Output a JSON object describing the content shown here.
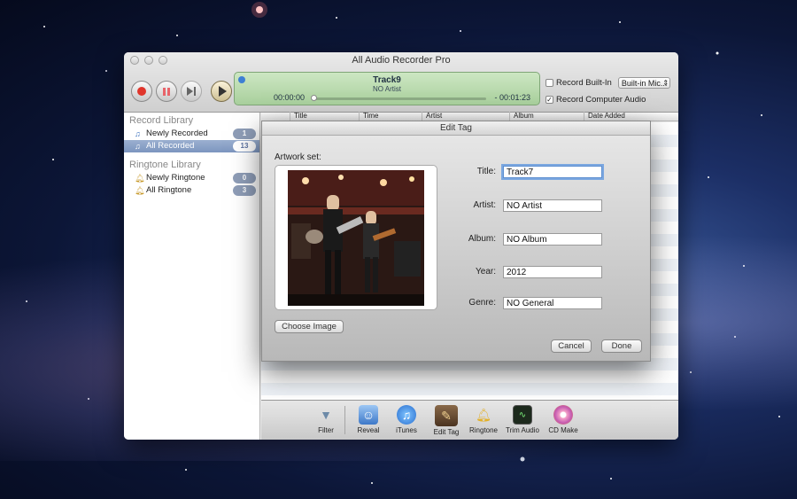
{
  "window": {
    "title": "All Audio Recorder Pro"
  },
  "player": {
    "track": "Track9",
    "artist": "NO Artist",
    "elapsed": "00:00:00",
    "remaining": "- 00:01:23",
    "progress": 0
  },
  "options": {
    "record_builtin_label": "Record Built-In",
    "record_builtin_checked": false,
    "input_select": "Built-in Mic...",
    "record_computer_label": "Record Computer Audio",
    "record_computer_checked": true,
    "check_mark": "✓"
  },
  "sidebar": {
    "record_library": "Record Library",
    "record_items": [
      {
        "label": "Newly Recorded",
        "count": "1",
        "icon": "music-note-icon",
        "selected": false
      },
      {
        "label": "All Recorded",
        "count": "13",
        "icon": "music-note-icon",
        "selected": true
      }
    ],
    "ringtone_library": "Ringtone Library",
    "ringtone_items": [
      {
        "label": "Newly Ringtone",
        "count": "0",
        "icon": "bell-icon"
      },
      {
        "label": "All Ringtone",
        "count": "3",
        "icon": "bell-icon"
      }
    ]
  },
  "table": {
    "columns": [
      "Title",
      "Time",
      "Artist",
      "Album",
      "Date Added"
    ]
  },
  "toolbar": {
    "items": [
      "Filter",
      "Reveal",
      "iTunes",
      "Edit Tag",
      "Ringtone",
      "Trim Audio",
      "CD Make"
    ]
  },
  "dialog": {
    "title": "Edit Tag",
    "artwork_label": "Artwork set:",
    "choose_image": "Choose Image",
    "fields": {
      "title_label": "Title:",
      "title_value": "Track7",
      "artist_label": "Artist:",
      "artist_value": "NO Artist",
      "album_label": "Album:",
      "album_value": "NO Album",
      "year_label": "Year:",
      "year_value": "2012",
      "genre_label": "Genre:",
      "genre_value": "NO General"
    },
    "cancel": "Cancel",
    "done": "Done"
  },
  "colors": {
    "lcd": "#b7dbab",
    "selection": "#8aa0c8",
    "record_red": "#e0352b"
  }
}
